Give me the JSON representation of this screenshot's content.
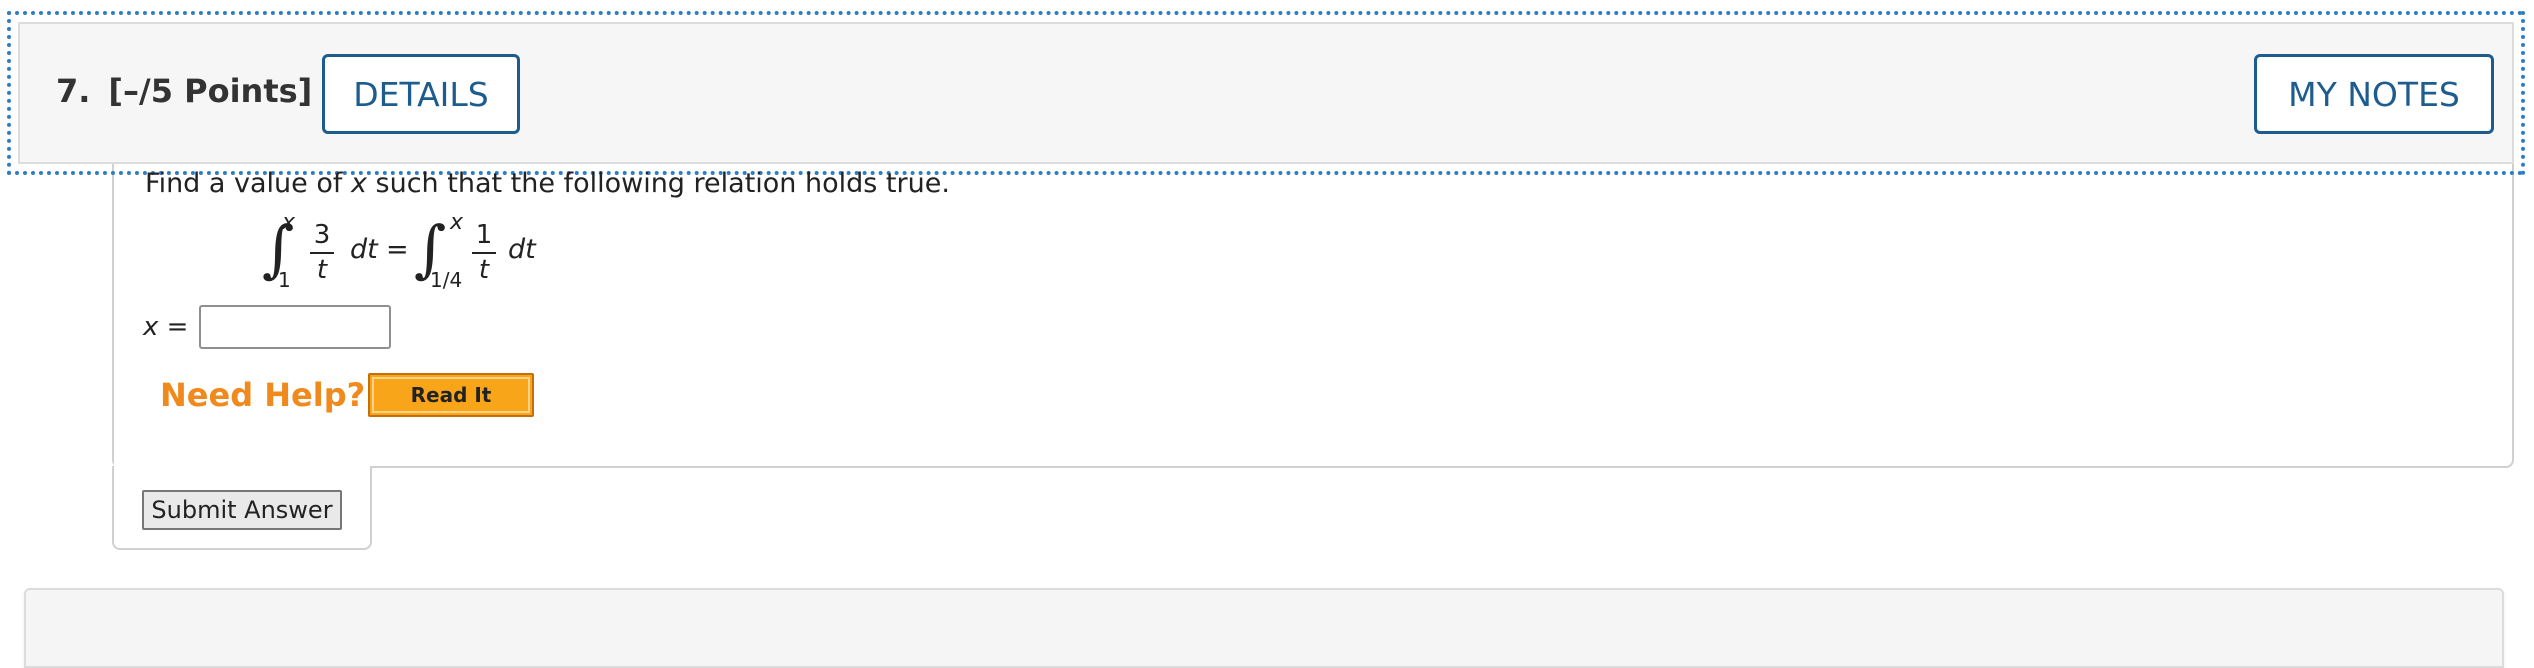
{
  "question": {
    "number": "7.",
    "points": "[–/5 Points]",
    "details_label": "DETAILS",
    "notes_label": "MY NOTES",
    "prompt_prefix": "Find a value of ",
    "prompt_var": "x",
    "prompt_suffix": " such that the following relation holds true.",
    "equation": {
      "left": {
        "upper": "x",
        "lower": "1",
        "numerator": "3",
        "denominator": "t",
        "differential": "dt"
      },
      "equals": "=",
      "right": {
        "upper": "x",
        "lower": "1/4",
        "numerator": "1",
        "denominator": "t",
        "differential": "dt"
      }
    },
    "answer_var": "x",
    "answer_equals": "=",
    "answer_value": "",
    "need_help_label": "Need Help?",
    "read_it_label": "Read It",
    "submit_label": "Submit Answer"
  },
  "colors": {
    "accent_blue": "#1c5c8e",
    "focus_outline": "#2f7ec5",
    "help_orange": "#f08a1c",
    "read_it_bg": "#f9a51a"
  }
}
